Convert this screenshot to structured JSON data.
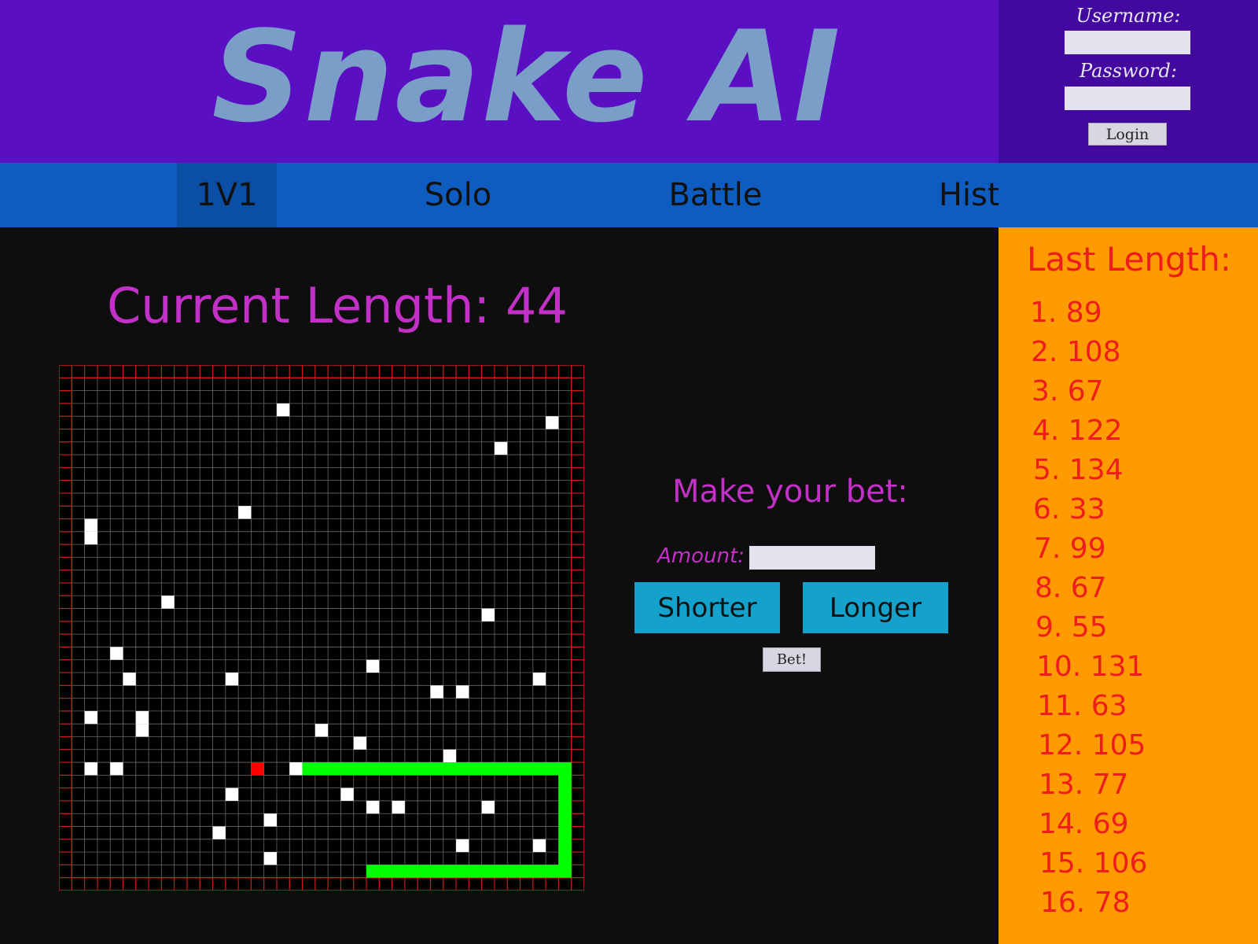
{
  "header": {
    "title": "Snake AI",
    "login": {
      "username_label": "Username:",
      "password_label": "Password:",
      "username_value": "",
      "password_value": "",
      "login_button": "Login"
    }
  },
  "nav": {
    "items": [
      {
        "label": "1V1",
        "active": true
      },
      {
        "label": "Solo",
        "active": false
      },
      {
        "label": "Battle",
        "active": false
      },
      {
        "label": "History",
        "active": false
      }
    ]
  },
  "game": {
    "current_length_label": "Current Length:",
    "current_length_value": "44",
    "grid_size": 39,
    "colors": {
      "snake": "#00ff00",
      "food": "#ff0000",
      "obstacle": "#ffffff",
      "border": "#cc1a1a",
      "grid": "#6a6a6a"
    },
    "obstacles": [
      [
        16,
        2
      ],
      [
        37,
        3
      ],
      [
        33,
        5
      ],
      [
        13,
        10
      ],
      [
        1,
        11
      ],
      [
        1,
        12
      ],
      [
        7,
        17
      ],
      [
        32,
        18
      ],
      [
        3,
        21
      ],
      [
        4,
        23
      ],
      [
        12,
        23
      ],
      [
        23,
        22
      ],
      [
        36,
        23
      ],
      [
        28,
        24
      ],
      [
        30,
        24
      ],
      [
        1,
        26
      ],
      [
        5,
        26
      ],
      [
        5,
        27
      ],
      [
        19,
        27
      ],
      [
        22,
        28
      ],
      [
        29,
        29
      ],
      [
        1,
        30
      ],
      [
        3,
        30
      ],
      [
        17,
        30
      ],
      [
        12,
        32
      ],
      [
        21,
        32
      ],
      [
        23,
        33
      ],
      [
        25,
        33
      ],
      [
        32,
        33
      ],
      [
        15,
        34
      ],
      [
        11,
        35
      ],
      [
        30,
        36
      ],
      [
        36,
        36
      ],
      [
        15,
        37
      ]
    ],
    "food": [
      14,
      30
    ],
    "snake_path": [
      [
        18,
        30
      ],
      [
        38,
        30
      ],
      [
        38,
        38
      ],
      [
        23,
        38
      ]
    ]
  },
  "bet": {
    "title": "Make your bet:",
    "amount_label": "Amount:",
    "amount_value": "",
    "shorter_label": "Shorter",
    "longer_label": "Longer",
    "bet_button": "Bet!"
  },
  "history": {
    "title": "Last Length:",
    "entries": [
      "1. 89",
      "2. 108",
      "3. 67",
      "4. 122",
      "5. 134",
      "6. 33",
      "7. 99",
      "8. 67",
      "9. 55",
      "10. 131",
      "11. 63",
      "12. 105",
      "13. 77",
      "14. 69",
      "15. 106",
      "16. 78"
    ]
  }
}
